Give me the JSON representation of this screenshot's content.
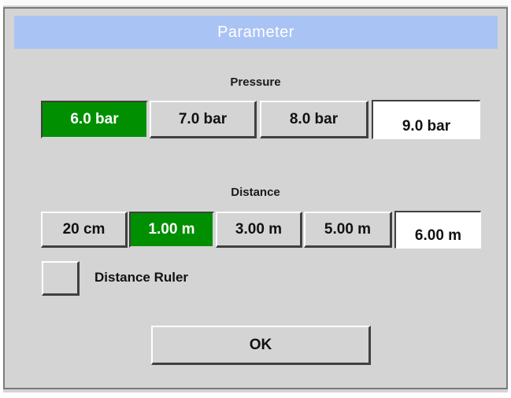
{
  "dialog": {
    "title": "Parameter"
  },
  "pressure": {
    "label": "Pressure",
    "options": [
      "6.0 bar",
      "7.0 bar",
      "8.0 bar"
    ],
    "selected": "6.0 bar",
    "custom_value": "9.0 bar"
  },
  "distance": {
    "label": "Distance",
    "options": [
      "20 cm",
      "1.00 m",
      "3.00 m",
      "5.00 m"
    ],
    "selected": "1.00 m",
    "custom_value": "6.00 m"
  },
  "ruler": {
    "label": "Distance Ruler",
    "checked": false
  },
  "actions": {
    "ok_label": "OK"
  },
  "colors": {
    "title_bar": "#a9c4f4",
    "selected": "#008f00",
    "panel": "#d4d4d4"
  }
}
